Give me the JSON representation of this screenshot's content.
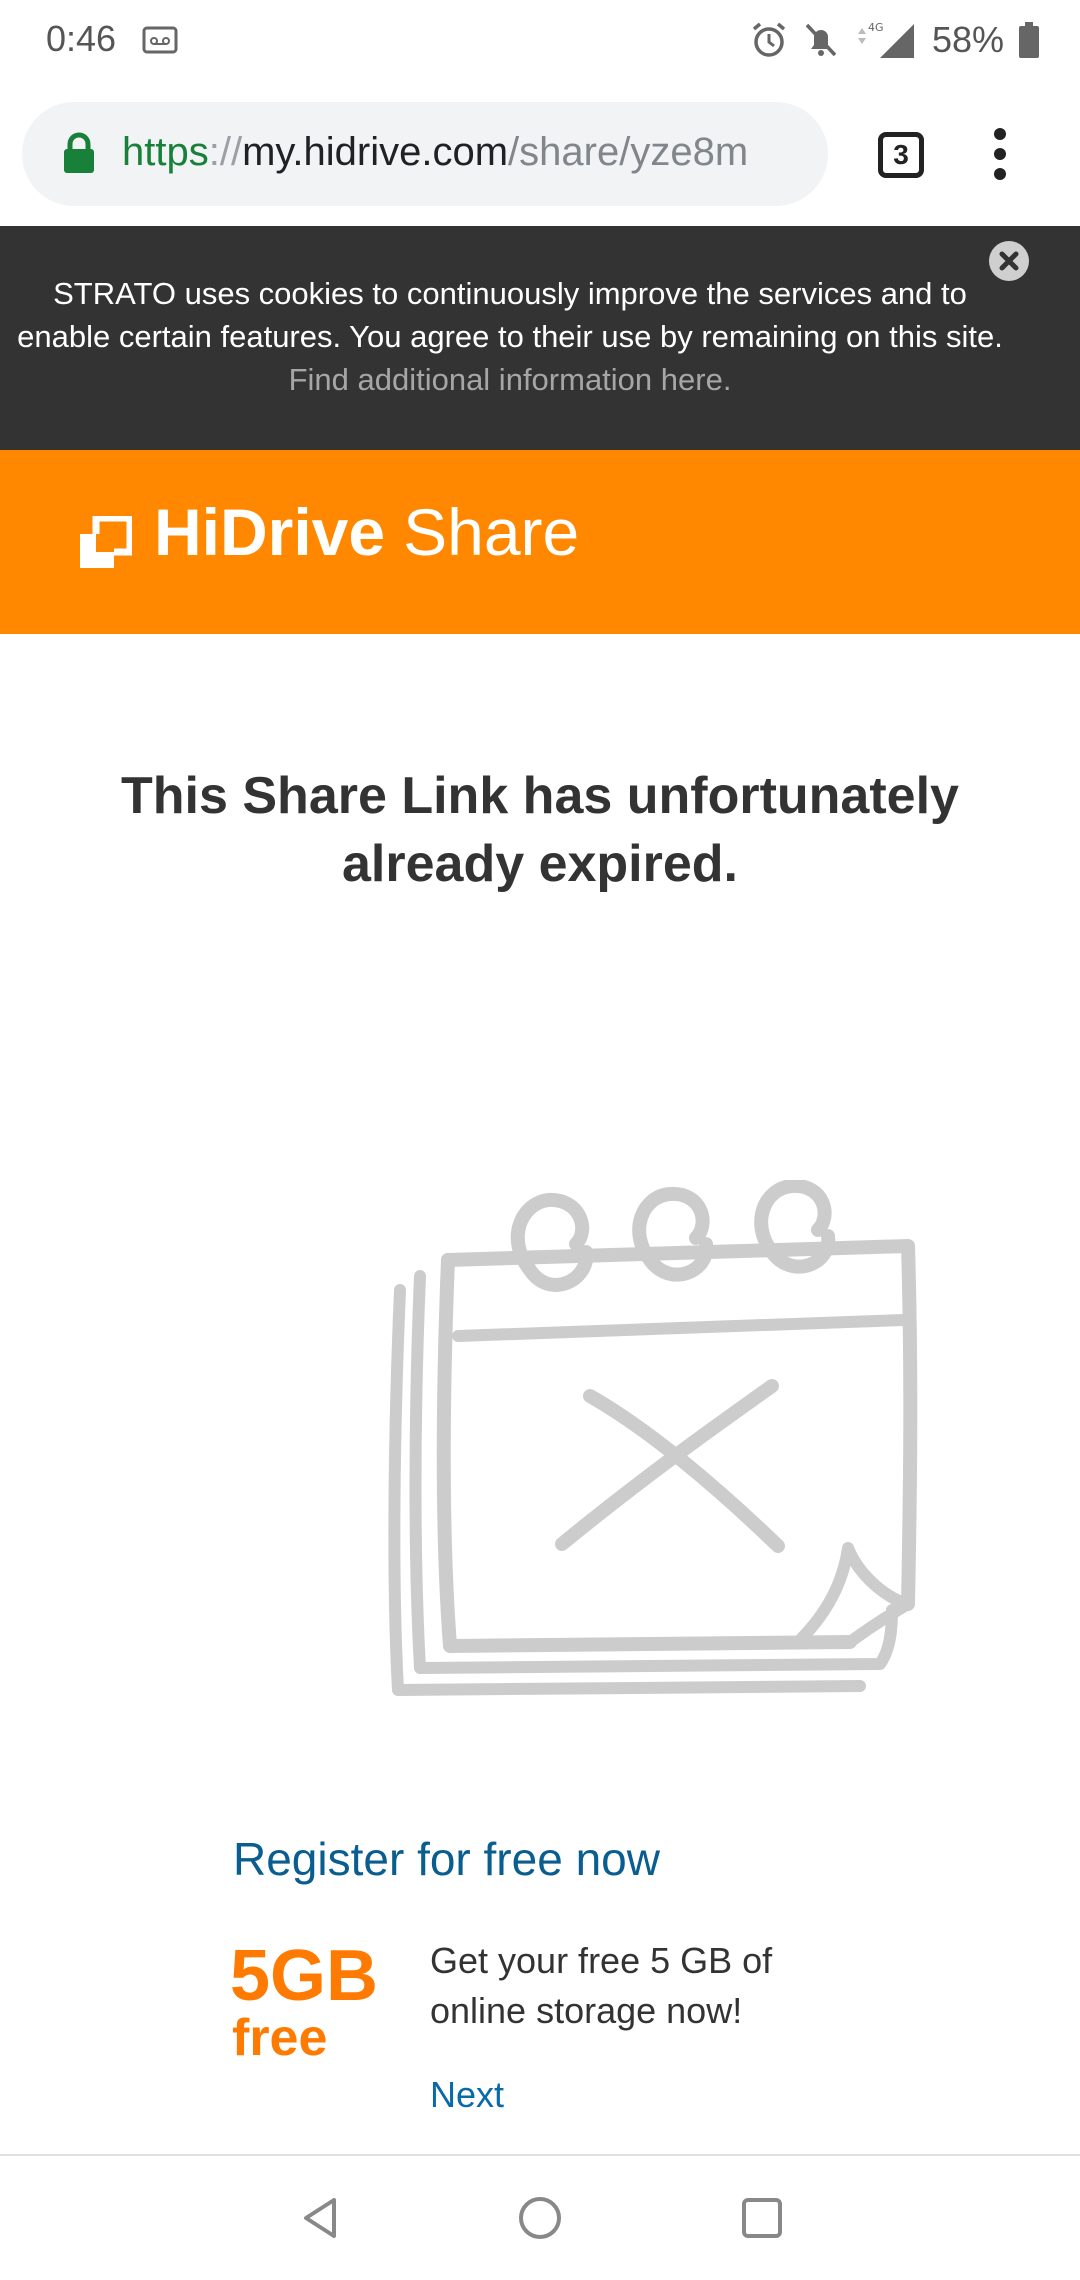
{
  "status_bar": {
    "time": "0:46",
    "network": "4G",
    "battery": "58%"
  },
  "browser": {
    "url_scheme": "https",
    "url_separator": "://",
    "url_host": "my.hidrive.com",
    "url_path": "/share/yze8m",
    "tab_count": "3"
  },
  "cookie_banner": {
    "text": "STRATO uses cookies to continuously improve the services and to enable certain features. You agree to their use by remaining on this site. ",
    "link": "Find additional information here."
  },
  "header": {
    "brand": "HiDrive",
    "product": "Share"
  },
  "main": {
    "title": "This Share Link has unfortunately already expired."
  },
  "promo": {
    "register_label": "Register for free now",
    "badge_size": "5GB",
    "badge_free": "free",
    "description": "Get your free 5 GB of online storage now!",
    "next_label": "Next"
  },
  "colors": {
    "brand_orange": "#ff8800",
    "banner_bg": "#333333",
    "link_blue": "#0a5d8f"
  }
}
